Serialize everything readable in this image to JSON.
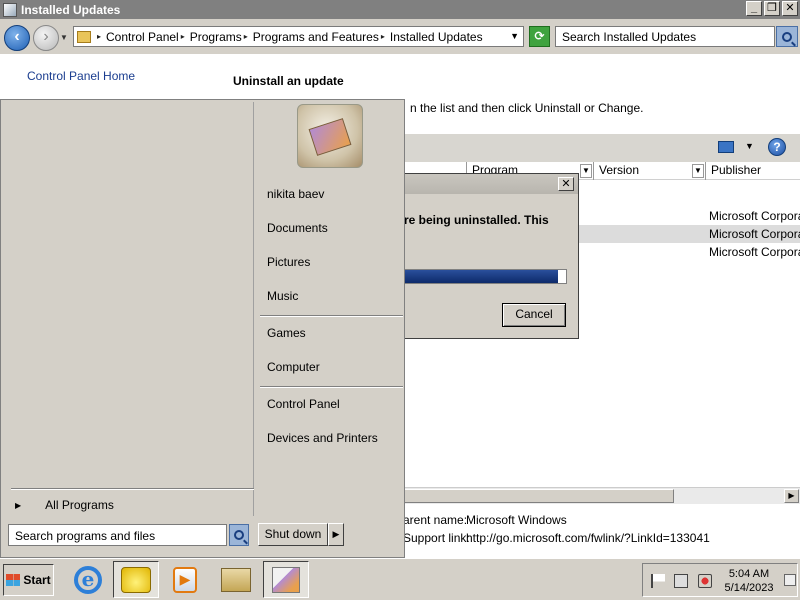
{
  "window": {
    "title": "Installed Updates",
    "buttons": {
      "minimize": "_",
      "restore": "❐",
      "close": "✕"
    }
  },
  "address": {
    "crumbs": [
      "Control Panel",
      "Programs",
      "Programs and Features",
      "Installed Updates"
    ],
    "search_placeholder": "Search Installed Updates"
  },
  "left_pane": {
    "home_link": "Control Panel Home"
  },
  "main": {
    "heading": "Uninstall an update",
    "instruction": "n the list and then click Uninstall or Change.",
    "columns": [
      "Program",
      "Version",
      "Publisher"
    ],
    "rows": [
      {
        "publisher": "Microsoft Corporat",
        "selected": false
      },
      {
        "publisher": "Microsoft Corporat",
        "selected": true
      },
      {
        "publisher": "Microsoft Corporat",
        "selected": false
      }
    ],
    "details": {
      "parent_label": "arent name:",
      "parent_value": "Microsoft Windows",
      "support_label": "Support link:",
      "support_value": "http://go.microsoft.com/fwlink/?LinkId=133041"
    }
  },
  "dialog": {
    "message": "re being uninstalled. This",
    "progress": 0.95,
    "cancel_label": "Cancel",
    "close": "✕"
  },
  "start_menu": {
    "user_name": "nikita baev",
    "items_group1": [
      "Documents",
      "Pictures",
      "Music"
    ],
    "items_group2": [
      "Games",
      "Computer"
    ],
    "items_group3": [
      "Control Panel",
      "Devices and Printers"
    ],
    "all_programs": "All Programs",
    "search_placeholder": "Search programs and files",
    "shutdown_label": "Shut down"
  },
  "taskbar": {
    "start_label": "Start",
    "apps": [
      "internet-explorer-icon",
      "windows-explorer-icon",
      "media-player-icon",
      "server-manager-icon",
      "control-panel-icon"
    ],
    "clock_time": "5:04 AM",
    "clock_date": "5/14/2023"
  }
}
